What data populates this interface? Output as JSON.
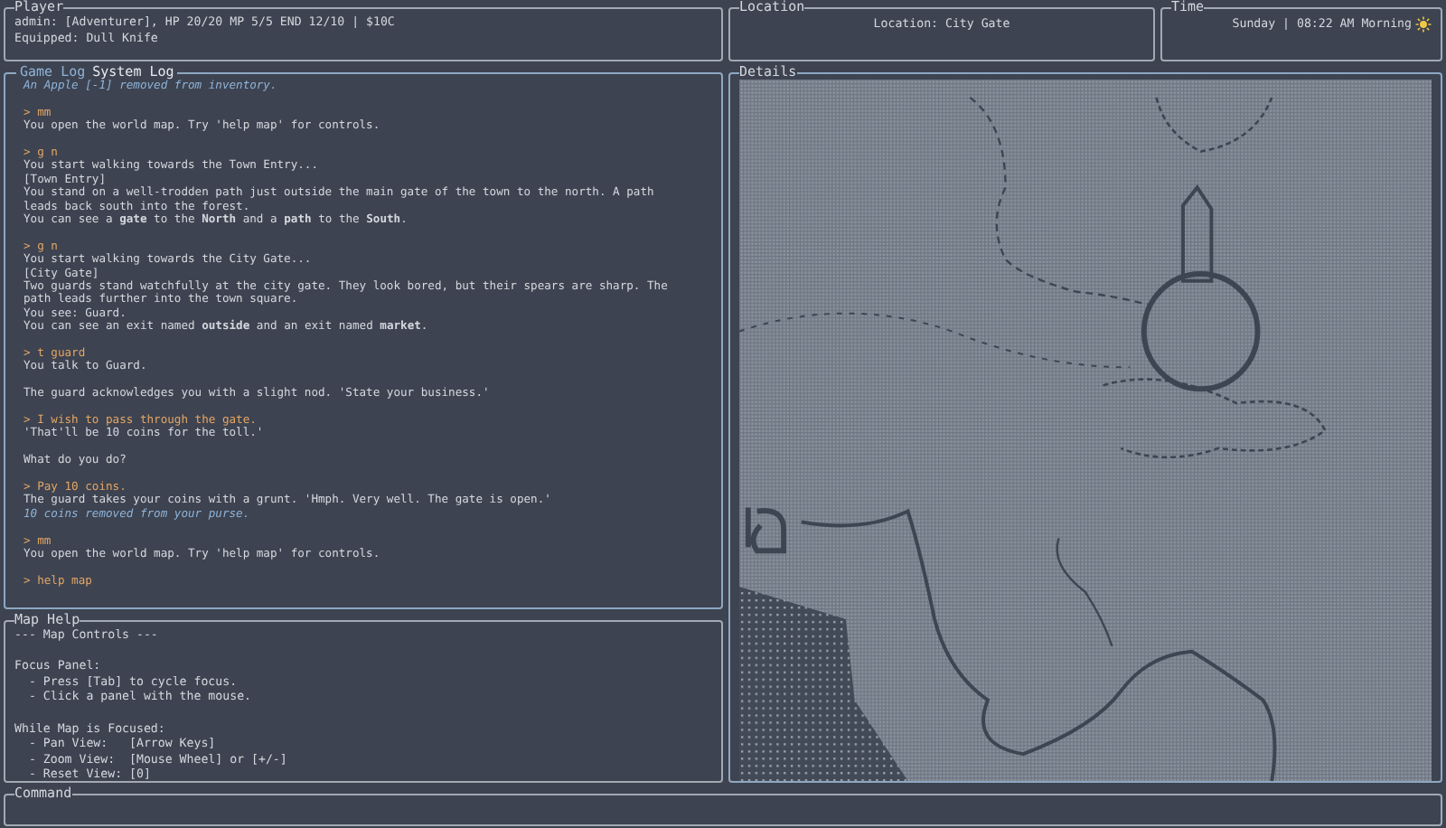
{
  "player": {
    "title": "Player",
    "lines": [
      "admin: [Adventurer], HP 20/20 MP 5/5 END 12/10 | $10C",
      "Equipped: Dull Knife"
    ]
  },
  "location": {
    "title": "Location",
    "text": "Location: City Gate"
  },
  "time": {
    "title": "Time",
    "text": "Sunday | 08:22 AM Morning"
  },
  "log": {
    "tabs": [
      {
        "label": "Game Log",
        "selected": true
      },
      {
        "label": "System Log",
        "selected": false
      }
    ],
    "entries": [
      [
        {
          "kind": "info",
          "text": "An Apple [-1] removed from inventory."
        }
      ],
      [
        {
          "kind": "command",
          "text": "> mm"
        },
        {
          "kind": "text",
          "text": "You open the world map. Try 'help map' for controls."
        }
      ],
      [
        {
          "kind": "command",
          "text": "> g n"
        },
        {
          "kind": "text",
          "text": "You start walking towards the Town Entry..."
        },
        {
          "kind": "text",
          "text": "[Town Entry]"
        },
        {
          "kind": "text",
          "text": "You stand on a well-trodden path just outside the main gate of the town to the north. A path"
        },
        {
          "kind": "text",
          "text": "leads back south into the forest."
        },
        {
          "kind": "text",
          "text": "You can see a **gate** to the **North** and a **path** to the **South**."
        }
      ],
      [
        {
          "kind": "command",
          "text": "> g n"
        },
        {
          "kind": "text",
          "text": "You start walking towards the City Gate..."
        },
        {
          "kind": "text",
          "text": "[City Gate]"
        },
        {
          "kind": "text",
          "text": "Two guards stand watchfully at the city gate. They look bored, but their spears are sharp. The"
        },
        {
          "kind": "text",
          "text": "path leads further into the town square."
        },
        {
          "kind": "text",
          "text": "You see: Guard."
        },
        {
          "kind": "text",
          "text": "You can see an exit named **outside** and an exit named **market**."
        }
      ],
      [
        {
          "kind": "command",
          "text": "> t guard"
        },
        {
          "kind": "text",
          "text": "You talk to Guard."
        }
      ],
      [
        {
          "kind": "text",
          "text": "The guard acknowledges you with a slight nod. 'State your business.'"
        }
      ],
      [
        {
          "kind": "command",
          "text": "> I wish to pass through the gate."
        },
        {
          "kind": "text",
          "text": "'That'll be 10 coins for the toll.'"
        }
      ],
      [
        {
          "kind": "text",
          "text": "What do you do?"
        }
      ],
      [
        {
          "kind": "command",
          "text": "> Pay 10 coins."
        },
        {
          "kind": "text",
          "text": "The guard takes your coins with a grunt. 'Hmph. Very well. The gate is open.'"
        },
        {
          "kind": "info",
          "text": "10 coins removed from your purse."
        }
      ],
      [
        {
          "kind": "command",
          "text": "> mm"
        },
        {
          "kind": "text",
          "text": "You open the world map. Try 'help map' for controls."
        }
      ],
      [
        {
          "kind": "command",
          "text": "> help map"
        }
      ]
    ]
  },
  "map_help": {
    "title": "Map Help",
    "groups": [
      [
        "--- Map Controls ---"
      ],
      [
        "Focus Panel:",
        "  - Press [Tab] to cycle focus.",
        "  - Click a panel with the mouse."
      ],
      [
        "While Map is Focused:",
        "  - Pan View:   [Arrow Keys]",
        "  - Zoom View:  [Mouse Wheel] or [+/-]",
        "  - Reset View: [0]"
      ]
    ]
  },
  "details": {
    "title": "Details"
  },
  "command": {
    "title": "Command"
  }
}
